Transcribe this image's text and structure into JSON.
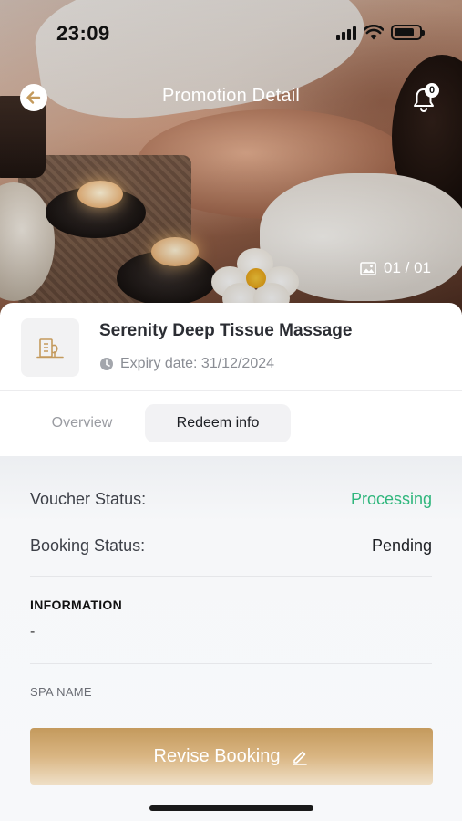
{
  "status_bar": {
    "time": "23:09"
  },
  "nav": {
    "title": "Promotion Detail",
    "notification_count": "0"
  },
  "hero": {
    "image_counter": "01 / 01"
  },
  "promotion": {
    "title": "Serenity Deep Tissue Massage",
    "expiry": "Expiry date: 31/12/2024"
  },
  "tabs": [
    {
      "label": "Overview",
      "active": false
    },
    {
      "label": "Redeem info",
      "active": true
    }
  ],
  "redeem_info": {
    "voucher_status_label": "Voucher Status:",
    "voucher_status_value": "Processing",
    "booking_status_label": "Booking Status:",
    "booking_status_value": "Pending",
    "information_heading": "INFORMATION",
    "information_value": "-",
    "spa_name_label": "SPA NAME"
  },
  "actions": {
    "revise_label": "Revise Booking"
  },
  "colors": {
    "processing": "#2fb67c",
    "accent_gold": "#c49a5d"
  },
  "icons": [
    "back-arrow-icon",
    "bell-icon",
    "image-icon",
    "building-icon",
    "clock-icon",
    "edit-icon"
  ]
}
